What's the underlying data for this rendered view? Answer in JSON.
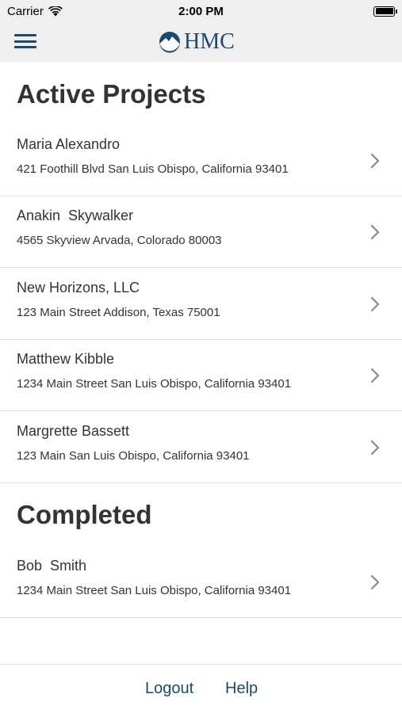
{
  "status": {
    "carrier": "Carrier",
    "time": "2:00 PM"
  },
  "header": {
    "logo_text": "HMC",
    "brand_color": "#1b4a6e"
  },
  "active": {
    "title": "Active Projects",
    "items": [
      {
        "name": "Maria Alexandro",
        "address": "421 Foothill Blvd San Luis Obispo, California 93401"
      },
      {
        "name": "Anakin  Skywalker",
        "address": "4565 Skyview Arvada, Colorado 80003"
      },
      {
        "name": "New Horizons, LLC",
        "address": "123 Main Street Addison, Texas 75001"
      },
      {
        "name": "Matthew Kibble",
        "address": "1234 Main Street San Luis Obispo, California 93401"
      },
      {
        "name": "Margrette Bassett",
        "address": "123 Main San Luis Obispo, California 93401"
      }
    ]
  },
  "completed": {
    "title": "Completed",
    "items": [
      {
        "name": "Bob  Smith",
        "address": "1234 Main Street San Luis Obispo, California 93401"
      }
    ]
  },
  "footer": {
    "logout_label": "Logout",
    "help_label": "Help"
  }
}
